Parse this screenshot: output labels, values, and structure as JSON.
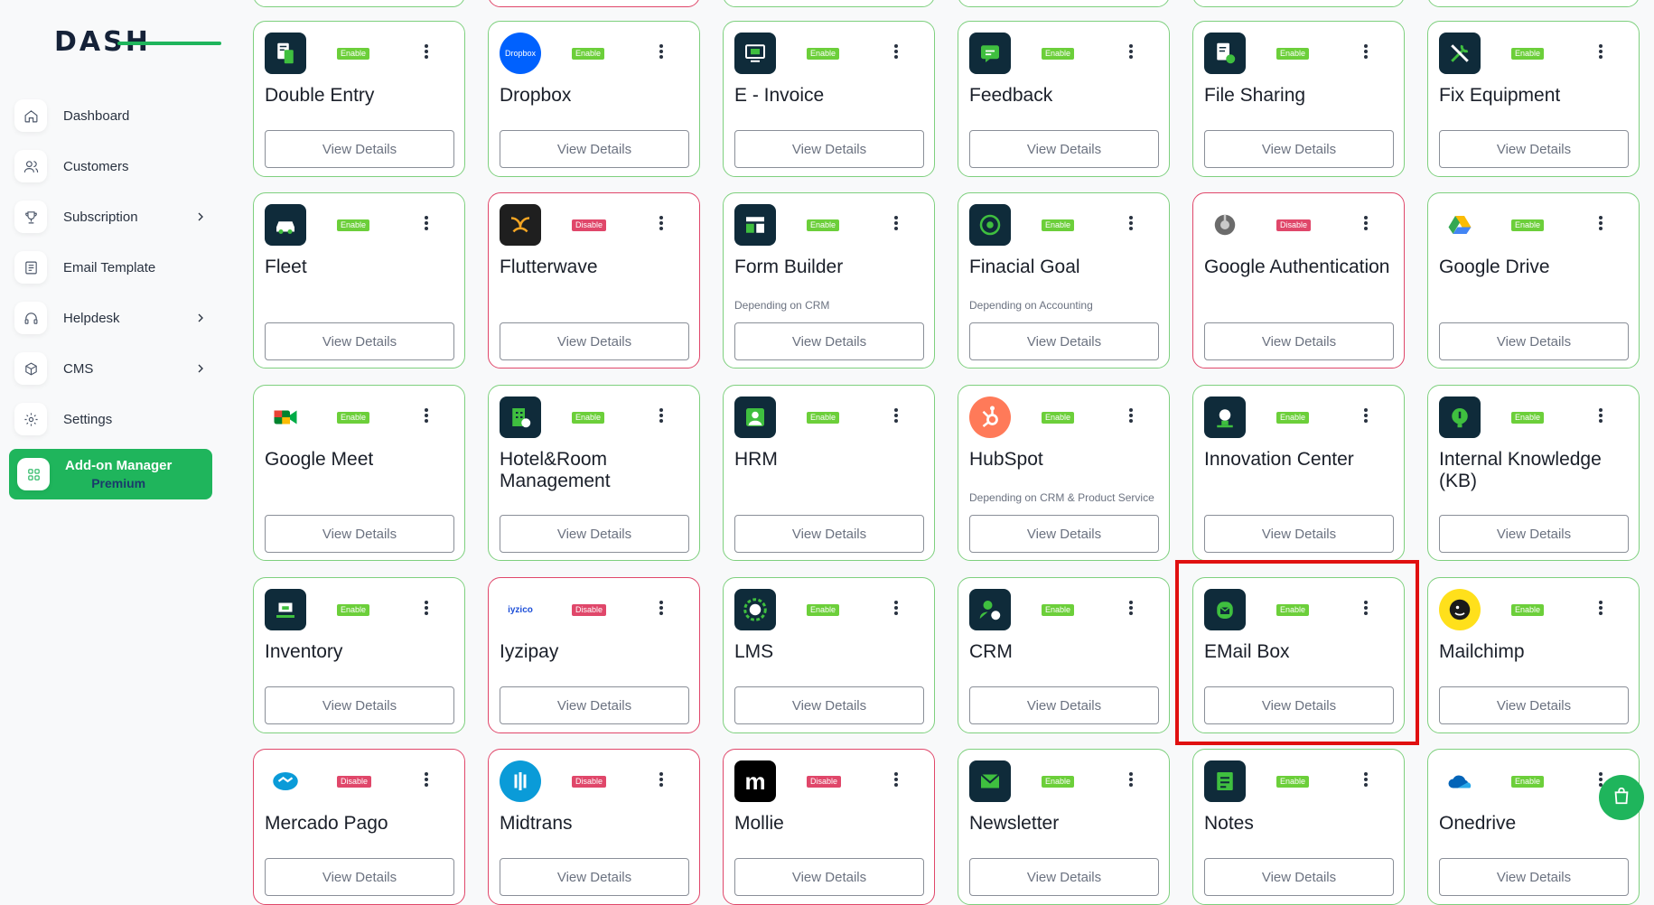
{
  "brand": {
    "logo_text": "DASH"
  },
  "sidebar": {
    "items": [
      {
        "label": "Dashboard",
        "icon": "home-icon"
      },
      {
        "label": "Customers",
        "icon": "users-icon"
      },
      {
        "label": "Subscription",
        "icon": "trophy-icon"
      },
      {
        "label": "Email Template",
        "icon": "template-icon"
      },
      {
        "label": "Helpdesk",
        "icon": "headset-icon"
      },
      {
        "label": "CMS",
        "icon": "box-icon"
      },
      {
        "label": "Settings",
        "icon": "gear-icon"
      }
    ],
    "active": {
      "label": "Add-on Manager",
      "sub": "Premium",
      "icon": "grid-icon"
    }
  },
  "addons": [
    {
      "title": "Double Entry",
      "status": "Enable",
      "button": "View Details",
      "icon": "document-icon"
    },
    {
      "title": "Dropbox",
      "status": "Enable",
      "button": "View Details",
      "icon": "dropbox-icon",
      "icon_text": "Dropbox"
    },
    {
      "title": "E - Invoice",
      "status": "Enable",
      "button": "View Details",
      "icon": "invoice-icon"
    },
    {
      "title": "Feedback",
      "status": "Enable",
      "button": "View Details",
      "icon": "feedback-icon"
    },
    {
      "title": "File Sharing",
      "status": "Enable",
      "button": "View Details",
      "icon": "file-share-icon"
    },
    {
      "title": "Fix Equipment",
      "status": "Enable",
      "button": "View Details",
      "icon": "tools-icon"
    },
    {
      "title": "Fleet",
      "status": "Enable",
      "button": "View Details",
      "icon": "car-icon"
    },
    {
      "title": "Flutterwave",
      "status": "Disable",
      "button": "View Details",
      "icon": "flutterwave-icon"
    },
    {
      "title": "Form Builder",
      "status": "Enable",
      "button": "View Details",
      "sub": "Depending on CRM",
      "icon": "form-icon"
    },
    {
      "title": "Finacial Goal",
      "status": "Enable",
      "button": "View Details",
      "sub": "Depending on Accounting",
      "icon": "target-icon"
    },
    {
      "title": "Google Authentication",
      "status": "Disable",
      "button": "View Details",
      "icon": "google-auth-icon"
    },
    {
      "title": "Google Drive",
      "status": "Enable",
      "button": "View Details",
      "icon": "google-drive-icon"
    },
    {
      "title": "Google Meet",
      "status": "Enable",
      "button": "View Details",
      "icon": "google-meet-icon"
    },
    {
      "title": "Hotel&Room Management",
      "status": "Enable",
      "button": "View Details",
      "icon": "hotel-icon"
    },
    {
      "title": "HRM",
      "status": "Enable",
      "button": "View Details",
      "icon": "person-icon"
    },
    {
      "title": "HubSpot",
      "status": "Enable",
      "button": "View Details",
      "sub": "Depending on CRM & Product Service",
      "icon": "hubspot-icon"
    },
    {
      "title": "Innovation Center",
      "status": "Enable",
      "button": "View Details",
      "icon": "idea-icon"
    },
    {
      "title": "Internal Knowledge (KB)",
      "status": "Enable",
      "button": "View Details",
      "icon": "knowledge-icon"
    },
    {
      "title": "Inventory",
      "status": "Enable",
      "button": "View Details",
      "icon": "inventory-icon"
    },
    {
      "title": "Iyzipay",
      "status": "Disable",
      "button": "View Details",
      "icon": "iyzico-icon",
      "icon_text": "iyzico"
    },
    {
      "title": "LMS",
      "status": "Enable",
      "button": "View Details",
      "icon": "lms-icon"
    },
    {
      "title": "CRM",
      "status": "Enable",
      "button": "View Details",
      "icon": "crm-icon"
    },
    {
      "title": "EMail Box",
      "status": "Enable",
      "button": "View Details",
      "icon": "mailbox-icon"
    },
    {
      "title": "Mailchimp",
      "status": "Enable",
      "button": "View Details",
      "icon": "mailchimp-icon"
    },
    {
      "title": "Mercado Pago",
      "status": "Disable",
      "button": "View Details",
      "icon": "handshake-icon"
    },
    {
      "title": "Midtrans",
      "status": "Disable",
      "button": "View Details",
      "icon": "midtrans-icon"
    },
    {
      "title": "Mollie",
      "status": "Disable",
      "button": "View Details",
      "icon": "mollie-icon",
      "icon_text": "m"
    },
    {
      "title": "Newsletter",
      "status": "Enable",
      "button": "View Details",
      "icon": "newsletter-icon"
    },
    {
      "title": "Notes",
      "status": "Enable",
      "button": "View Details",
      "icon": "notes-icon"
    },
    {
      "title": "Onedrive",
      "status": "Enable",
      "button": "View Details",
      "icon": "onedrive-icon"
    }
  ],
  "floating": {
    "icon": "shopping-bag-icon"
  }
}
